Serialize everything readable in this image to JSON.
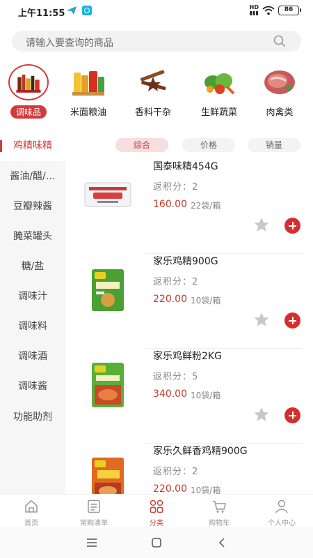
{
  "status_bar": {
    "time": "上午11:55",
    "signal": "HD",
    "battery": "86"
  },
  "search": {
    "placeholder": "请输入要查询的商品"
  },
  "categories": [
    {
      "label": "调味品",
      "selected": true,
      "icon": "condiments-image"
    },
    {
      "label": "米面粮油",
      "selected": false,
      "icon": "grain-oil-image"
    },
    {
      "label": "香料干杂",
      "selected": false,
      "icon": "spices-image"
    },
    {
      "label": "生鲜蔬菜",
      "selected": false,
      "icon": "vegetables-image"
    },
    {
      "label": "肉禽类",
      "selected": false,
      "icon": "meat-image"
    }
  ],
  "sidebar": {
    "items": [
      {
        "label": "鸡精味精",
        "active": true
      },
      {
        "label": "酱油/醋/…",
        "active": false
      },
      {
        "label": "豆瓣辣酱",
        "active": false
      },
      {
        "label": "腌菜罐头",
        "active": false
      },
      {
        "label": "糖/盐",
        "active": false
      },
      {
        "label": "调味汁",
        "active": false
      },
      {
        "label": "调味料",
        "active": false
      },
      {
        "label": "调味酒",
        "active": false
      },
      {
        "label": "调味酱",
        "active": false
      },
      {
        "label": "功能助剂",
        "active": false
      }
    ]
  },
  "sort_tabs": [
    {
      "label": "综合",
      "active": true
    },
    {
      "label": "价格",
      "active": false
    },
    {
      "label": "销量",
      "active": false
    }
  ],
  "products": [
    {
      "name": "国泰味精454G",
      "points": "返积分：2",
      "price": "160.00",
      "unit": "22袋/箱",
      "image": "msg-bag-image"
    },
    {
      "name": "家乐鸡精900G",
      "points": "返积分：2",
      "price": "220.00",
      "unit": "10袋/箱",
      "image": "chicken-essence-bag-image"
    },
    {
      "name": "家乐鸡鲜粉2KG",
      "points": "返积分：5",
      "price": "340.00",
      "unit": "10袋/箱",
      "image": "chicken-powder-bag-image"
    },
    {
      "name": "家乐久鲜香鸡精900G",
      "points": "返积分：2",
      "price": "220.00",
      "unit": "10袋/箱",
      "image": "chicken-essence-red-bag-image"
    }
  ],
  "bottom_nav": [
    {
      "label": "首页",
      "icon": "home-icon",
      "active": false
    },
    {
      "label": "常购清单",
      "icon": "list-icon",
      "active": false
    },
    {
      "label": "分类",
      "icon": "grid-icon",
      "active": true
    },
    {
      "label": "购物车",
      "icon": "cart-icon",
      "active": false
    },
    {
      "label": "个人中心",
      "icon": "person-icon",
      "active": false
    }
  ],
  "colors": {
    "accent": "#d43a3a",
    "price": "#c43a2a"
  }
}
